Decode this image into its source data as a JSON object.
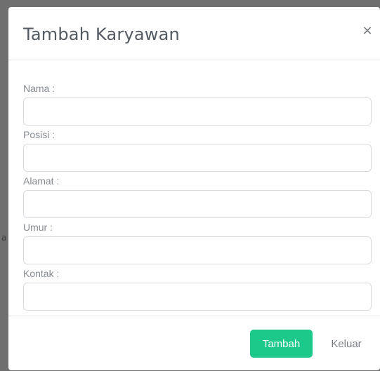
{
  "modal": {
    "title": "Tambah Karyawan",
    "close_label": "×"
  },
  "form": {
    "fields": [
      {
        "label": "Nama :",
        "value": "",
        "placeholder": ""
      },
      {
        "label": "Posisi :",
        "value": "",
        "placeholder": ""
      },
      {
        "label": "Alamat :",
        "value": "",
        "placeholder": ""
      },
      {
        "label": "Umur :",
        "value": "",
        "placeholder": ""
      },
      {
        "label": "Kontak :",
        "value": "",
        "placeholder": ""
      }
    ]
  },
  "footer": {
    "submit_label": "Tambah",
    "cancel_label": "Keluar"
  },
  "background": {
    "partial_text": "a"
  },
  "colors": {
    "accent": "#1cc88a",
    "backdrop": "#6f6f6f"
  },
  "icons": {
    "close": "close-icon"
  }
}
